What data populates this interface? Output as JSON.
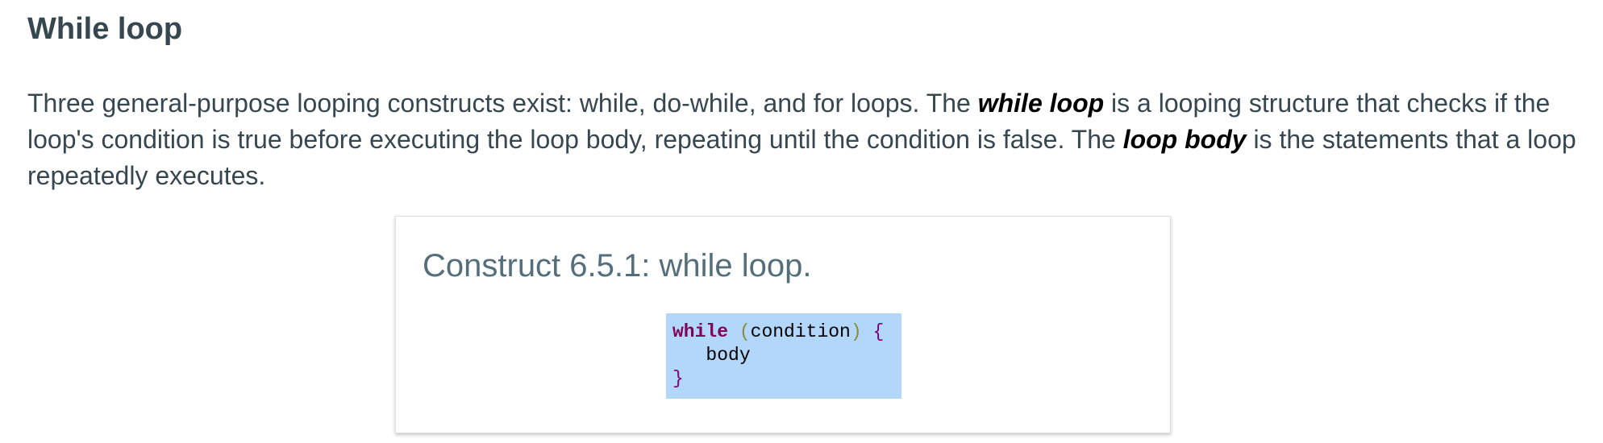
{
  "heading": "While loop",
  "paragraph": {
    "t1": "Three general-purpose looping constructs exist: while, do-while, and for loops. The ",
    "term1": "while loop",
    "t2": " is a looping structure that checks if the loop's condition is true before executing the loop body, repeating until the condition is false. The ",
    "term2": "loop body",
    "t3": " is the statements that a loop repeatedly executes."
  },
  "construct": {
    "title": "Construct 6.5.1: while loop.",
    "code": {
      "keyword": "while",
      "open_paren": "(",
      "condition": "condition",
      "close_paren": ")",
      "open_brace": "{",
      "indent": "   ",
      "body": "body",
      "close_brace": "}"
    }
  }
}
